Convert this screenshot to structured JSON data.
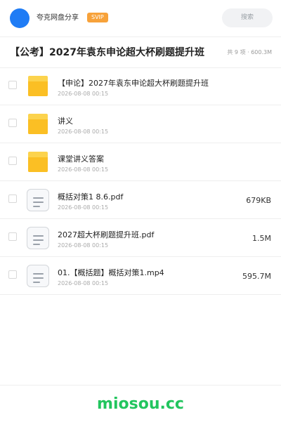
{
  "header": {
    "brand": "夸克网盘分享",
    "badge": "SVIP",
    "search_label": "搜索"
  },
  "folder": {
    "title": "【公考】2027年袁东申论超大杯刷题提升班",
    "meta": "共 9 项 · 600.3M"
  },
  "files": [
    {
      "type": "folder",
      "icon": "folder-icon",
      "name": "【申论】2027年袁东申论超大杯刷题提升班",
      "date": "2026-08-08 00:15",
      "size": ""
    },
    {
      "type": "folder",
      "icon": "folder-icon",
      "name": "讲义",
      "date": "2026-08-08 00:15",
      "size": ""
    },
    {
      "type": "folder",
      "icon": "folder-icon",
      "name": "课堂讲义答案",
      "date": "2026-08-08 00:15",
      "size": ""
    },
    {
      "type": "file",
      "icon": "document-icon",
      "name": "概括对策1 8.6.pdf",
      "date": "2026-08-08 00:15",
      "size": "679KB"
    },
    {
      "type": "file",
      "icon": "document-icon",
      "name": "2027超大杯刷题提升班.pdf",
      "date": "2026-08-08 00:15",
      "size": "1.5M"
    },
    {
      "type": "file",
      "icon": "document-icon",
      "name": "01.【概括题】概括对策1.mp4",
      "date": "2026-08-08 00:15",
      "size": "595.7M"
    }
  ],
  "footer": {
    "watermark": "miosou.cc"
  },
  "colors": {
    "avatar": "#1f7cf5",
    "badge": "#f7a23a",
    "folder": "#fbbf24",
    "watermark": "#22c55e"
  }
}
